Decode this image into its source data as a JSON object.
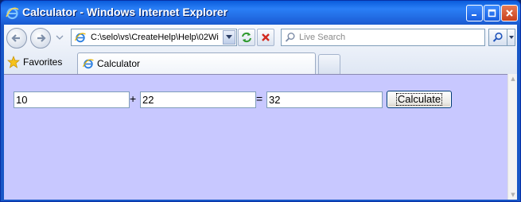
{
  "window": {
    "title": "Calculator - Windows Internet Explorer"
  },
  "toolbar": {
    "address": "C:\\selo\\vs\\CreateHelp\\Help\\02Wi",
    "search_placeholder": "Live Search"
  },
  "favorites": {
    "label": "Favorites"
  },
  "tab": {
    "label": "Calculator"
  },
  "calculator": {
    "operand1": "10",
    "operator": "+",
    "operand2": "22",
    "equals": "=",
    "result": "32",
    "button_label": "Calculate"
  },
  "colors": {
    "page_background": "#c8c8ff",
    "titlebar": "#1e62da"
  }
}
